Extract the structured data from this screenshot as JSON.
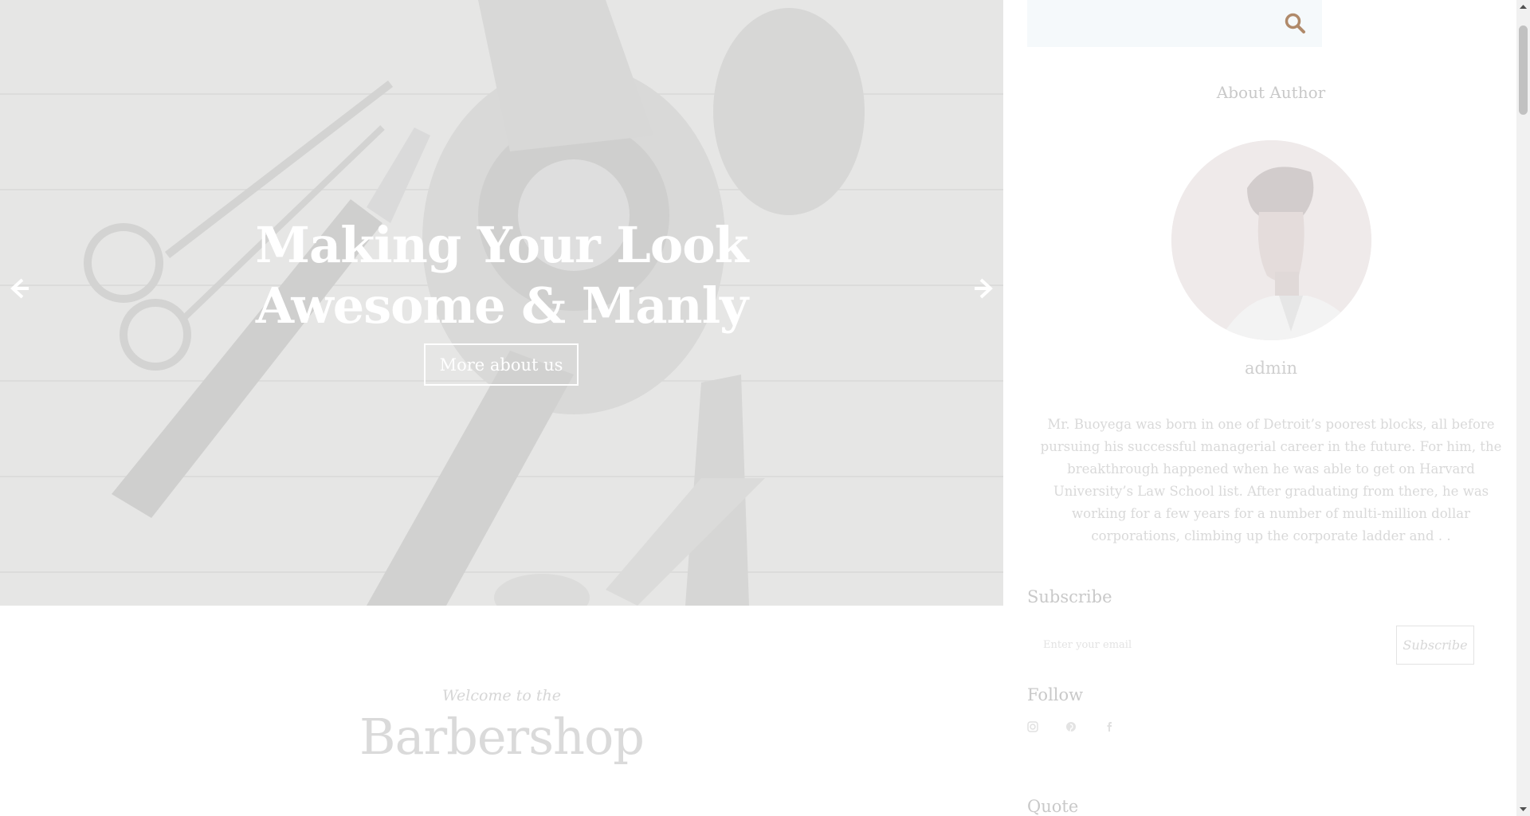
{
  "hero": {
    "title_line1": "Making Your Look",
    "title_line2": "Awesome & Manly",
    "button_label": "More about us",
    "prev_icon": "arrow-left-icon",
    "next_icon": "arrow-right-icon"
  },
  "welcome": {
    "subtitle": "Welcome to the",
    "title": "Barbershop"
  },
  "sidebar": {
    "search": {
      "placeholder": "",
      "icon": "search-icon",
      "accent": "#b08a6a"
    },
    "about": {
      "title": "About Author",
      "name": "admin",
      "bio": "Mr. Buoyega was born in one of Detroit’s poorest blocks, all before pursuing his successful managerial career in the future. For him, the breakthrough happened when he was able to get on Harvard University’s Law School list. After graduating from there, he was working for a few years for a number of multi-million dollar corporations, climbing up the corporate ladder and . ."
    },
    "subscribe": {
      "title": "Subscribe",
      "placeholder": "Enter your email",
      "button_label": "Subscribe"
    },
    "follow": {
      "title": "Follow",
      "icons": [
        "instagram-icon",
        "pinterest-icon",
        "facebook-icon"
      ]
    },
    "quote": {
      "title": "Quote"
    }
  },
  "colors": {
    "accent": "#b08a6a",
    "muted_text": "#c9c9c9"
  }
}
